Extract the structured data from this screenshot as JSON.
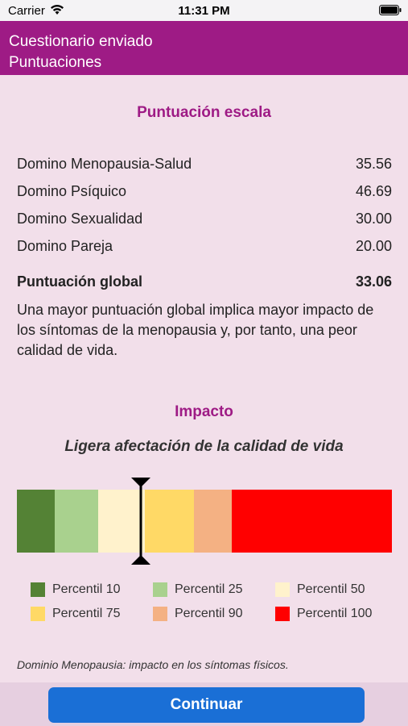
{
  "status_bar": {
    "carrier": "Carrier",
    "time": "11:31 PM"
  },
  "header": {
    "line1": "Cuestionario enviado",
    "line2": "Puntuaciones"
  },
  "scores": {
    "title": "Puntuación escala",
    "rows": [
      {
        "label": "Domino Menopausia-Salud",
        "value": "35.56"
      },
      {
        "label": "Domino Psíquico",
        "value": "46.69"
      },
      {
        "label": "Domino Sexualidad",
        "value": "30.00"
      },
      {
        "label": "Domino Pareja",
        "value": "20.00"
      }
    ],
    "global_label": "Puntuación global",
    "global_value": "33.06",
    "description": "Una mayor puntuación global implica mayor impacto de los síntomas de la menopausia y, por tanto, una peor calidad de vida."
  },
  "impact": {
    "title": "Impacto",
    "text": "Ligera afectación de la calidad de vida",
    "marker_level": 0.33,
    "segments": [
      {
        "color": "#548235",
        "fraction": 0.1
      },
      {
        "color": "#a9d18e",
        "fraction": 0.115
      },
      {
        "color": "#fff2cc",
        "fraction": 0.125
      },
      {
        "color": "#ffd966",
        "fraction": 0.13
      },
      {
        "color": "#f4b183",
        "fraction": 0.1
      },
      {
        "color": "#ff0000",
        "fraction": 0.43
      }
    ],
    "legend": [
      {
        "label": "Percentil 10",
        "color": "#548235"
      },
      {
        "label": "Percentil 25",
        "color": "#a9d18e"
      },
      {
        "label": "Percentil 50",
        "color": "#fff2cc"
      },
      {
        "label": "Percentil 75",
        "color": "#ffd966"
      },
      {
        "label": "Percentil 90",
        "color": "#f4b183"
      },
      {
        "label": "Percentil 100",
        "color": "#ff0000"
      }
    ]
  },
  "footnote": "Dominio Menopausia: impacto en los síntomas físicos.",
  "continue_label": "Continuar"
}
